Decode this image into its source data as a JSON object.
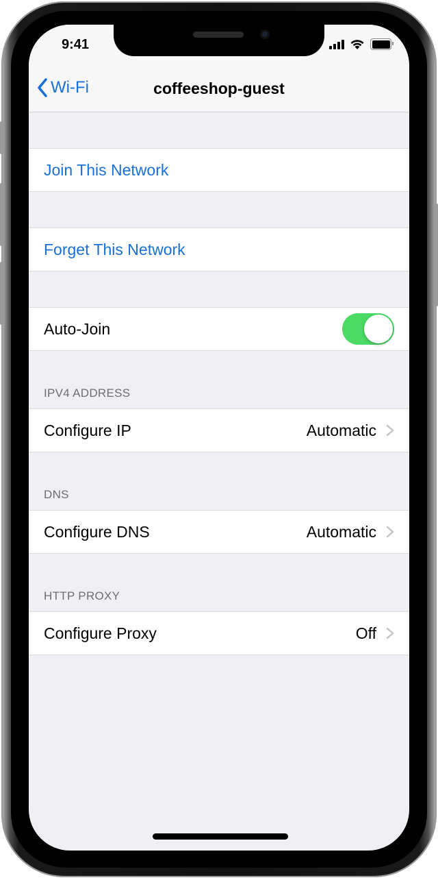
{
  "status_bar": {
    "time": "9:41",
    "icons": [
      "signal-icon",
      "wifi-icon",
      "battery-icon"
    ]
  },
  "nav": {
    "back_label": "Wi-Fi",
    "title": "coffeeshop-guest"
  },
  "actions": {
    "join": "Join This Network",
    "forget": "Forget This Network"
  },
  "auto_join": {
    "label": "Auto-Join",
    "enabled": true
  },
  "sections": {
    "ipv4": {
      "header": "IPV4 ADDRESS",
      "label": "Configure IP",
      "value": "Automatic"
    },
    "dns": {
      "header": "DNS",
      "label": "Configure DNS",
      "value": "Automatic"
    },
    "proxy": {
      "header": "HTTP PROXY",
      "label": "Configure Proxy",
      "value": "Off"
    }
  },
  "colors": {
    "accent": "#1a6fd6",
    "toggle_on": "#4cd964",
    "background": "#efeff4"
  }
}
